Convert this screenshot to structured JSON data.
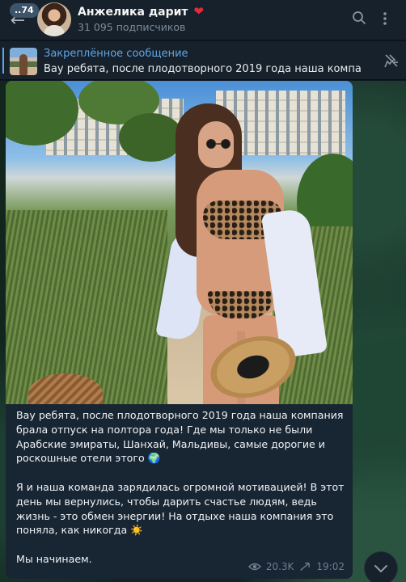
{
  "header": {
    "badge": "..74",
    "title": "Анжелика дарит",
    "title_emoji": "❤",
    "subscribers": "31 095 подписчиков"
  },
  "pinned": {
    "label": "Закреплённое сообщение",
    "text": "Вау ребята, после плодотворного 2019 года наша компания ..."
  },
  "message": {
    "paragraphs": [
      "Вау ребята, после плодотворного 2019 года наша компания брала отпуск на полтора года! Где мы только не были Арабские эмираты, Шанхай, Мальдивы, самые дорогие и роскошные отели этого 🌍",
      "Я и наша команда зарядилась огромной мотивацией! В этот день мы вернулись, чтобы дарить счастье людям, ведь жизнь - это обмен энергии! На отдыхе наша компания это поняла, как никогда ☀️",
      "Мы начинаем."
    ],
    "views": "20.3K",
    "time": "19:02"
  },
  "icons": {
    "back": "back-arrow-icon",
    "search": "search-icon",
    "more": "more-vertical-icon",
    "unpin": "unpin-icon",
    "views": "eye-icon",
    "forward": "forward-icon",
    "scroll": "chevron-down-icon"
  },
  "colors": {
    "accent": "#5ea5e6",
    "header_bg": "#17212b",
    "bubble_bg": "#182533"
  }
}
